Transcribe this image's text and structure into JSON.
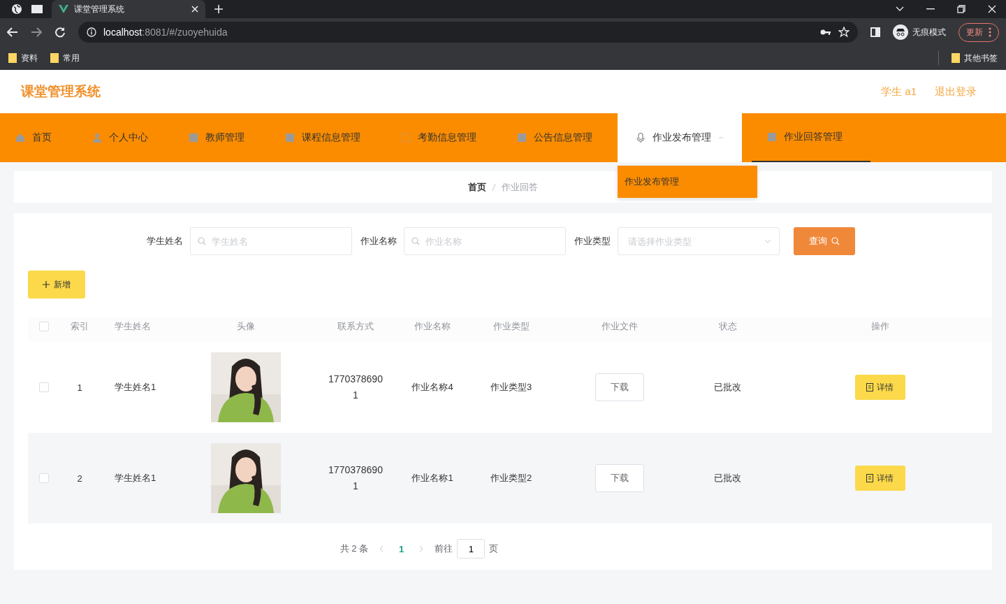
{
  "browser": {
    "tab_title": "课堂管理系统",
    "url": {
      "host": "localhost",
      "path": ":8081/#/zuoyehuida"
    },
    "incognito_label": "无痕模式",
    "update_button": "更新",
    "bookmarks": [
      {
        "label": "资料"
      },
      {
        "label": "常用"
      }
    ],
    "other_bookmarks": "其他书签"
  },
  "header": {
    "title": "课堂管理系统",
    "user": "学生 a1",
    "logout": "退出登录"
  },
  "nav": {
    "items": [
      {
        "label": "首页",
        "selected": false,
        "expanded": false
      },
      {
        "label": "个人中心",
        "selected": false,
        "expanded": false
      },
      {
        "label": "教师管理",
        "selected": false,
        "expanded": false
      },
      {
        "label": "课程信息管理",
        "selected": false,
        "expanded": false
      },
      {
        "label": "考勤信息管理",
        "selected": false,
        "expanded": false
      },
      {
        "label": "公告信息管理",
        "selected": false,
        "expanded": false
      },
      {
        "label": "作业发布管理",
        "selected": false,
        "expanded": true,
        "children": [
          {
            "label": "作业发布管理"
          }
        ]
      },
      {
        "label": "作业回答管理",
        "selected": true,
        "expanded": false
      }
    ]
  },
  "breadcrumb": [
    {
      "label": "首页"
    },
    {
      "label": "作业回答"
    }
  ],
  "search": {
    "fields": [
      {
        "kind": "text",
        "label": "学生姓名",
        "placeholder": "学生姓名"
      },
      {
        "kind": "text",
        "label": "作业名称",
        "placeholder": "作业名称"
      },
      {
        "kind": "select",
        "label": "作业类型",
        "placeholder": "请选择作业类型"
      }
    ],
    "button": "查询"
  },
  "add_button": "新增",
  "table": {
    "header_checked": false,
    "columns": [
      "索引",
      "学生姓名",
      "头像",
      "联系方式",
      "作业名称",
      "作业类型",
      "作业文件",
      "状态",
      "操作"
    ],
    "rows": [
      {
        "checked": false,
        "index": "1",
        "name": "学生姓名1",
        "phone": "17703786901",
        "homework": "作业名称4",
        "type": "作业类型3",
        "file_button": "下载",
        "status": "已批改",
        "action": "详情"
      },
      {
        "checked": false,
        "index": "2",
        "name": "学生姓名1",
        "phone": "17703786901",
        "homework": "作业名称1",
        "type": "作业类型2",
        "file_button": "下载",
        "status": "已批改",
        "action": "详情"
      }
    ]
  },
  "pager": {
    "total": "共 2 条",
    "pages": [
      {
        "label": "1",
        "selected": true
      }
    ],
    "goto_label": "前往",
    "goto_value": "1",
    "suffix": "页"
  }
}
